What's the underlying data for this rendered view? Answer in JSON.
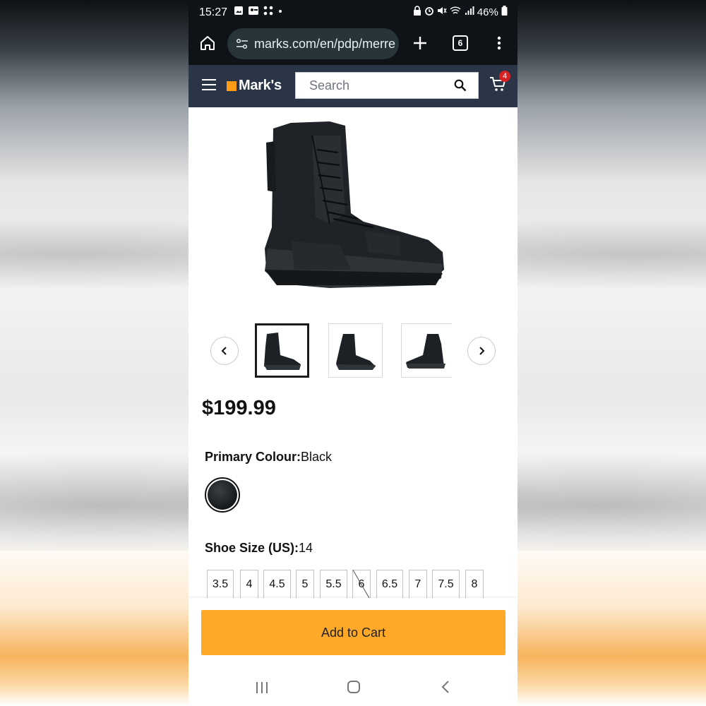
{
  "status_bar": {
    "time": "15:27",
    "battery": "46%",
    "icons": [
      "gallery-icon",
      "account-icon",
      "apps-icon",
      "dot-icon",
      "lock-icon",
      "alarm-icon",
      "mute-icon",
      "wifi-icon",
      "signal-icon",
      "battery-icon"
    ]
  },
  "browser": {
    "url": "marks.com/en/pdp/merre",
    "tab_count": "6"
  },
  "site_header": {
    "logo": "Mark's",
    "search_placeholder": "Search",
    "cart_count": "4",
    "colors": {
      "header_bg": "#2a3547",
      "logo_square": "#ff9b14",
      "badge": "#d7201f"
    }
  },
  "product": {
    "price": "$199.99",
    "thumbnails": [
      "boot-side-view",
      "boot-front-view",
      "boot-profile-view"
    ],
    "colour": {
      "label": "Primary Colour:",
      "value": "Black"
    },
    "size": {
      "label": "Shoe Size (US):",
      "value": "14",
      "options": [
        "3.5",
        "4",
        "4.5",
        "5",
        "5.5",
        "6",
        "6.5",
        "7",
        "7.5",
        "8"
      ],
      "unavailable": [
        "6"
      ]
    }
  },
  "cta": {
    "add_to_cart": "Add to Cart",
    "color": "#ffa92a"
  }
}
